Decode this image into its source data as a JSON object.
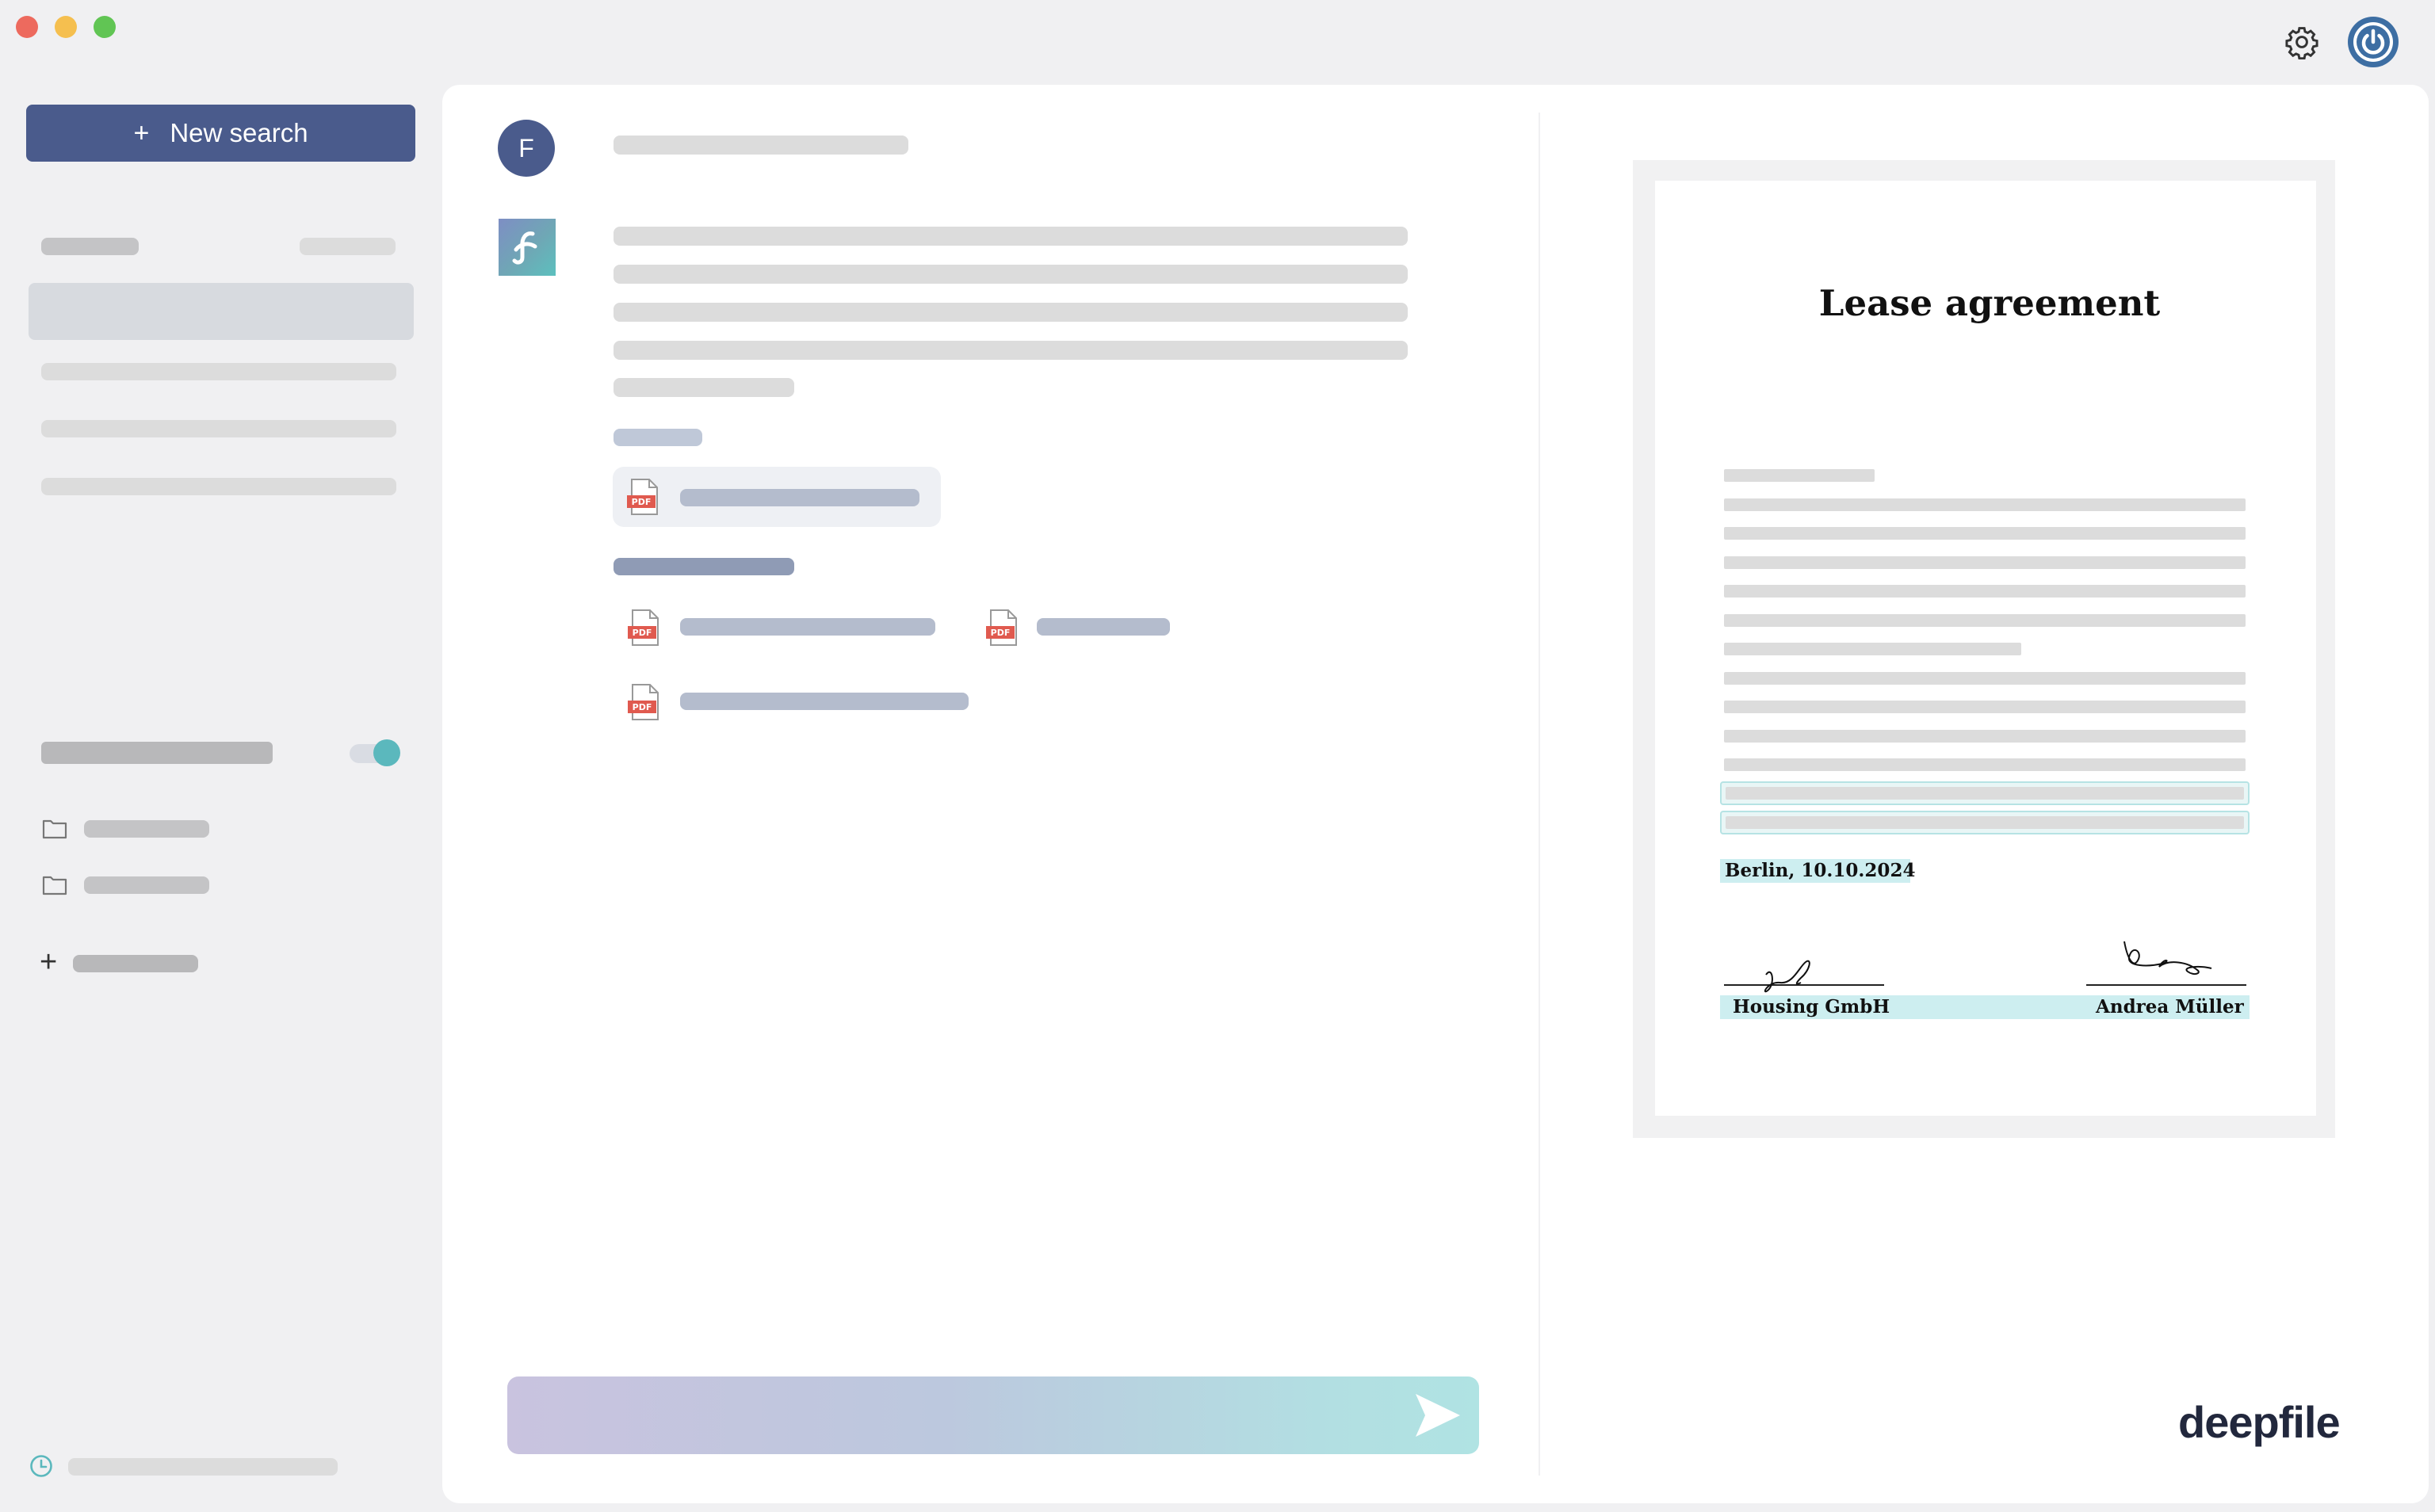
{
  "window": {
    "traffic_lights": [
      "#ed6a5e",
      "#f5bf4f",
      "#61c554"
    ]
  },
  "toolbar": {
    "settings_icon": "gear-icon",
    "power_icon": "power-icon"
  },
  "sidebar": {
    "new_search_plus": "+",
    "new_search_label": "New search",
    "folders_toggle_on": true,
    "add_icon": "+",
    "history_icon": "clock-icon"
  },
  "chat": {
    "user_avatar_letter": "F",
    "send_icon": "send-icon"
  },
  "document": {
    "title": "Lease agreement",
    "date_line": "Berlin, 10.10.2024",
    "signer_left": "Housing GmbH",
    "signer_right": "Andrea Müller"
  },
  "brand": {
    "name": "deepfile"
  },
  "colors": {
    "accent": "#4a5b8c",
    "highlight": "#cdeef0",
    "toggle": "#5bb8bd"
  }
}
